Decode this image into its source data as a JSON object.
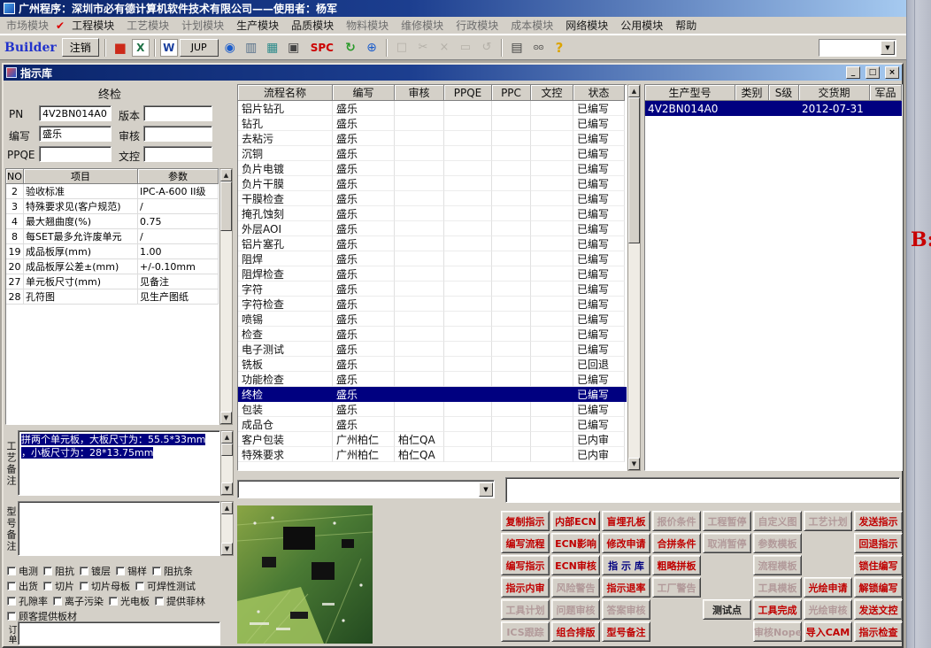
{
  "desktop": {
    "side_text": "B:"
  },
  "ui": {
    "up": "▲",
    "down": "▼",
    "dropdown": "▼"
  },
  "app": {
    "title": "广州程序：深圳市必有德计算机软件技术有限公司——使用者：杨军",
    "menu": [
      {
        "label": "市场模块",
        "cls": "dim"
      },
      {
        "label": "✔",
        "cls": "check"
      },
      {
        "label": "工程模块",
        "cls": "on"
      },
      {
        "label": "工艺模块",
        "cls": "dim"
      },
      {
        "label": "计划模块",
        "cls": "dim"
      },
      {
        "label": "生产模块",
        "cls": "on"
      },
      {
        "label": "品质模块",
        "cls": "on"
      },
      {
        "label": "物料模块",
        "cls": "dim"
      },
      {
        "label": "维修模块",
        "cls": "dim"
      },
      {
        "label": "行政模块",
        "cls": "dim"
      },
      {
        "label": "成本模块",
        "cls": "dim"
      },
      {
        "label": "网络模块",
        "cls": "on"
      },
      {
        "label": "公用模块",
        "cls": "on"
      },
      {
        "label": "帮助",
        "cls": "on"
      }
    ],
    "toolbar": {
      "builder": "Builder",
      "logout": "注销",
      "combo_value": "",
      "icons": [
        {
          "name": "toolbar-separator",
          "glyph": "",
          "cls": "sep"
        },
        {
          "name": "exit-icon",
          "glyph": "■",
          "cls": "ic-red"
        },
        {
          "name": "excel-icon",
          "glyph": "X",
          "cls": "ic-excel"
        },
        {
          "name": "toolbar-separator",
          "glyph": "",
          "cls": "sep"
        },
        {
          "name": "word-icon",
          "glyph": "W",
          "cls": "ic-word"
        },
        {
          "name": "jup-button",
          "glyph": "JUP",
          "cls": "ic-btn"
        },
        {
          "name": "preview-eye-icon",
          "glyph": "◉",
          "cls": "ic-blue"
        },
        {
          "name": "database-icon",
          "glyph": "▥",
          "cls": "ic-steel"
        },
        {
          "name": "network-icon",
          "glyph": "▦",
          "cls": "ic-teal"
        },
        {
          "name": "computer-icon",
          "glyph": "▣",
          "cls": "ic-dark"
        },
        {
          "name": "spc-button",
          "glyph": "SPC",
          "cls": "ic-spc"
        },
        {
          "name": "sync-icon",
          "glyph": "↻",
          "cls": "ic-green"
        },
        {
          "name": "globe-icon",
          "glyph": "⊕",
          "cls": "ic-globe"
        },
        {
          "name": "toolbar-separator",
          "glyph": "",
          "cls": "sep"
        },
        {
          "name": "new-page-icon",
          "glyph": "□",
          "cls": "ic-dis"
        },
        {
          "name": "cut-icon",
          "glyph": "✂",
          "cls": "ic-dis"
        },
        {
          "name": "delete-icon",
          "glyph": "×",
          "cls": "ic-dis"
        },
        {
          "name": "paste-icon",
          "glyph": "▭",
          "cls": "ic-dis"
        },
        {
          "name": "undo-icon",
          "glyph": "↺",
          "cls": "ic-dis"
        },
        {
          "name": "toolbar-separator",
          "glyph": "",
          "cls": "sep"
        },
        {
          "name": "print-icon",
          "glyph": "▤",
          "cls": "ic-dark"
        },
        {
          "name": "find-icon",
          "glyph": "⊙⊙",
          "cls": "ic-find"
        },
        {
          "name": "help-icon",
          "glyph": "?",
          "cls": "ic-help"
        }
      ]
    }
  },
  "window": {
    "title": "指示库",
    "min_glyph": "_",
    "max_glyph": "□",
    "close_glyph": "×"
  },
  "left_panel": {
    "stage_title": "终检",
    "form": {
      "pn_label": "PN",
      "pn": "4V2BN014A0",
      "version_label": "版本",
      "version": "",
      "writer_label": "编写",
      "writer": "盛乐",
      "audit_label": "审核",
      "audit": "",
      "ppqe_label": "PPQE",
      "ppqe": "",
      "doc_label": "文控",
      "doc": ""
    },
    "params": {
      "headers": [
        "NO",
        "项目",
        "参数"
      ],
      "rows": [
        [
          "2",
          "验收标准",
          "IPC-A-600 II级"
        ],
        [
          "3",
          "特殊要求见(客户规范)",
          "/"
        ],
        [
          "4",
          "最大翘曲度(%)",
          "0.75"
        ],
        [
          "8",
          "每SET最多允许废单元",
          "/"
        ],
        [
          "19",
          "成品板厚(mm)",
          "1.00"
        ],
        [
          "20",
          "成品板厚公差±(mm)",
          "+/-0.10mm"
        ],
        [
          "27",
          "单元板尺寸(mm)",
          "见备注"
        ],
        [
          "28",
          "孔符图",
          "见生产图纸"
        ]
      ]
    },
    "craft_note": {
      "label": "工艺备注",
      "line1": "拼两个单元板，大板尺寸为：55.5*33mm",
      "line2": "，小板尺寸为：28*13.75mm"
    },
    "model_note": {
      "label": "型号备注",
      "text": ""
    },
    "checkbox_rows": [
      [
        {
          "label": "电测"
        },
        {
          "label": "阻抗"
        },
        {
          "label": "镀层"
        },
        {
          "label": "锡样"
        },
        {
          "label": "阻抗条"
        }
      ],
      [
        {
          "label": "出货"
        },
        {
          "label": "切片"
        },
        {
          "label": "切片母板"
        },
        {
          "label": "可焊性测试"
        }
      ],
      [
        {
          "label": "孔隙率"
        },
        {
          "label": "离子污染"
        },
        {
          "label": "光电板"
        },
        {
          "label": "提供菲林"
        }
      ],
      [
        {
          "label": "顾客提供板材"
        }
      ]
    ],
    "order_label": "订单"
  },
  "process_table": {
    "headers": [
      "流程名称",
      "编写",
      "审核",
      "PPQE",
      "PPC",
      "文控",
      "状态"
    ],
    "rows": [
      {
        "name": "铝片钻孔",
        "writer": "盛乐",
        "audit": "",
        "status": "已编写"
      },
      {
        "name": "钻孔",
        "writer": "盛乐",
        "audit": "",
        "status": "已编写"
      },
      {
        "name": "去粘污",
        "writer": "盛乐",
        "audit": "",
        "status": "已编写"
      },
      {
        "name": "沉铜",
        "writer": "盛乐",
        "audit": "",
        "status": "已编写"
      },
      {
        "name": "负片电镀",
        "writer": "盛乐",
        "audit": "",
        "status": "已编写"
      },
      {
        "name": "负片干膜",
        "writer": "盛乐",
        "audit": "",
        "status": "已编写"
      },
      {
        "name": "干膜检查",
        "writer": "盛乐",
        "audit": "",
        "status": "已编写"
      },
      {
        "name": "掩孔蚀刻",
        "writer": "盛乐",
        "audit": "",
        "status": "已编写"
      },
      {
        "name": "外层AOI",
        "writer": "盛乐",
        "audit": "",
        "status": "已编写"
      },
      {
        "name": "铝片塞孔",
        "writer": "盛乐",
        "audit": "",
        "status": "已编写"
      },
      {
        "name": "阻焊",
        "writer": "盛乐",
        "audit": "",
        "status": "已编写"
      },
      {
        "name": "阻焊检查",
        "writer": "盛乐",
        "audit": "",
        "status": "已编写"
      },
      {
        "name": "字符",
        "writer": "盛乐",
        "audit": "",
        "status": "已编写"
      },
      {
        "name": "字符检查",
        "writer": "盛乐",
        "audit": "",
        "status": "已编写"
      },
      {
        "name": "喷锡",
        "writer": "盛乐",
        "audit": "",
        "status": "已编写"
      },
      {
        "name": "检查",
        "writer": "盛乐",
        "audit": "",
        "status": "已编写"
      },
      {
        "name": "电子测试",
        "writer": "盛乐",
        "audit": "",
        "status": "已编写"
      },
      {
        "name": "铣板",
        "writer": "盛乐",
        "audit": "",
        "status": "已回退"
      },
      {
        "name": "功能检查",
        "writer": "盛乐",
        "audit": "",
        "status": "已编写"
      },
      {
        "name": "终检",
        "writer": "盛乐",
        "audit": "",
        "status": "已编写",
        "selected": true
      },
      {
        "name": "包装",
        "writer": "盛乐",
        "audit": "",
        "status": "已编写"
      },
      {
        "name": "成品仓",
        "writer": "盛乐",
        "audit": "",
        "status": "已编写"
      },
      {
        "name": "客户包装",
        "writer": "广州柏仁",
        "audit": "柏仁QA",
        "status": "已内审"
      },
      {
        "name": "特殊要求",
        "writer": "广州柏仁",
        "audit": "柏仁QA",
        "status": "已内审"
      }
    ]
  },
  "model_table": {
    "headers": [
      "生产型号",
      "类别",
      "S级",
      "交货期",
      "军品"
    ],
    "rows": [
      {
        "model": "4V2BN014A0",
        "category": "",
        "grade": "",
        "delivery": "2012-07-31",
        "military": "",
        "selected": true
      }
    ]
  },
  "combos": {
    "combo1": "",
    "combo2": ""
  },
  "actions": {
    "cells": [
      {
        "label": "复制指示",
        "cls": "red"
      },
      {
        "label": "内部ECN",
        "cls": "red"
      },
      {
        "label": "盲埋孔板",
        "cls": "red"
      },
      {
        "label": "报价条件",
        "cls": "dim"
      },
      {
        "label": "工程暂停",
        "cls": "dim"
      },
      {
        "label": "自定义图",
        "cls": "dim"
      },
      {
        "label": "工艺计划",
        "cls": "dim"
      },
      {
        "label": "发送指示",
        "cls": "red"
      },
      {
        "label": "编写流程",
        "cls": "red"
      },
      {
        "label": "ECN影响",
        "cls": "red"
      },
      {
        "label": "修改申请",
        "cls": "red"
      },
      {
        "label": "合拼条件",
        "cls": "red"
      },
      {
        "label": "取消暂停",
        "cls": "dim"
      },
      {
        "label": "参数模板",
        "cls": "dim"
      },
      {
        "label": "",
        "cls": "empty"
      },
      {
        "label": "回退指示",
        "cls": "red"
      },
      {
        "label": "编写指示",
        "cls": "red"
      },
      {
        "label": "ECN审核",
        "cls": "red"
      },
      {
        "label": "指 示 库",
        "cls": "navy"
      },
      {
        "label": "粗略拼板",
        "cls": "red"
      },
      {
        "label": "",
        "cls": "empty"
      },
      {
        "label": "流程模板",
        "cls": "dim"
      },
      {
        "label": "",
        "cls": "empty"
      },
      {
        "label": "锁住编写",
        "cls": "red"
      },
      {
        "label": "指示内审",
        "cls": "red"
      },
      {
        "label": "风险警告",
        "cls": "dim"
      },
      {
        "label": "指示退率",
        "cls": "red"
      },
      {
        "label": "工厂警告",
        "cls": "dim"
      },
      {
        "label": "",
        "cls": "empty"
      },
      {
        "label": "工具模板",
        "cls": "dim"
      },
      {
        "label": "光绘申请",
        "cls": "red"
      },
      {
        "label": "解锁编写",
        "cls": "red"
      },
      {
        "label": "工具计划",
        "cls": "dim"
      },
      {
        "label": "问题审核",
        "cls": "dim"
      },
      {
        "label": "答案审核",
        "cls": "dim"
      },
      {
        "label": "",
        "cls": "empty"
      },
      {
        "label": "测试点",
        "cls": "dark"
      },
      {
        "label": "工具完成",
        "cls": "red"
      },
      {
        "label": "光绘审核",
        "cls": "dim"
      },
      {
        "label": "发送文控",
        "cls": "red"
      },
      {
        "label": "ICS跟踪",
        "cls": "dim"
      },
      {
        "label": "组合排版",
        "cls": "red"
      },
      {
        "label": "型号备注",
        "cls": "red"
      },
      {
        "label": "",
        "cls": "empty"
      },
      {
        "label": "",
        "cls": "empty"
      },
      {
        "label": "审核Nope",
        "cls": "dim"
      },
      {
        "label": "导入CAM",
        "cls": "red"
      },
      {
        "label": "指示检查",
        "cls": "red"
      }
    ]
  }
}
